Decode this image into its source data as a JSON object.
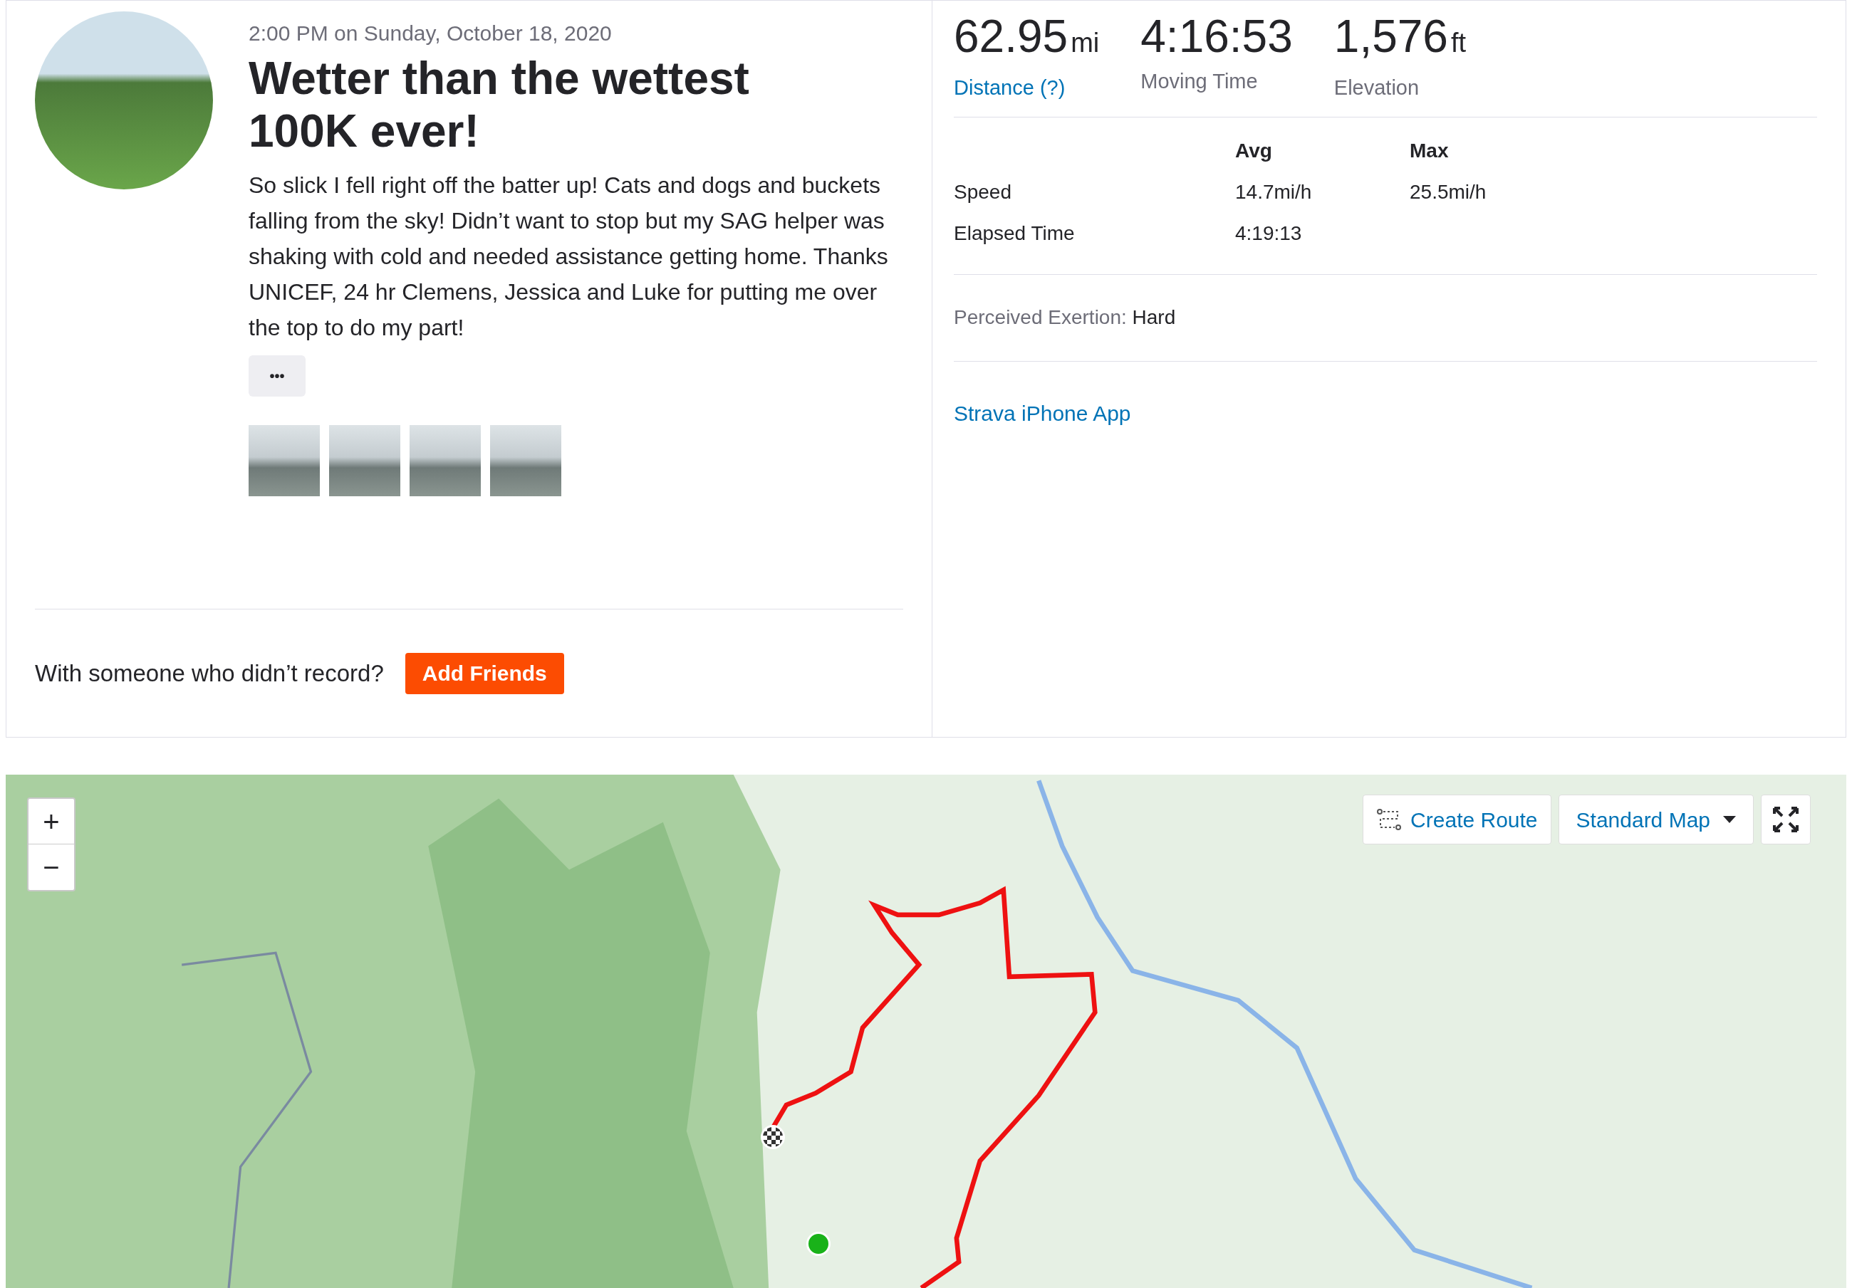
{
  "activity": {
    "date": "2:00 PM on Sunday, October 18, 2020",
    "title": "Wetter than the wettest 100K ever!",
    "description": "So slick I fell right off the batter up! Cats and dogs and buckets falling from the sky! Didn’t want to stop but my SAG helper was shaking with cold and needed assistance getting home. Thanks UNICEF, 24 hr Clemens, Jessica and Luke for putting me over the top to do my part!",
    "more_button": "•••"
  },
  "add_friends": {
    "prompt": "With someone who didn’t record?",
    "button": "Add Friends"
  },
  "stats": [
    {
      "value": "62.95",
      "unit": "mi",
      "label": "Distance (?)",
      "kind": "link"
    },
    {
      "value": "4:16:53",
      "label": "Moving Time",
      "kind": "plain"
    },
    {
      "value": "1,576",
      "unit": "ft",
      "label": "Elevation",
      "kind": "plain"
    }
  ],
  "table": {
    "columns": [
      "Avg",
      "Max"
    ],
    "rows": [
      {
        "label": "Speed",
        "avg": "14.7mi/h",
        "max": "25.5mi/h"
      },
      {
        "label": "Elapsed Time",
        "avg": "4:19:13"
      }
    ]
  },
  "exertion": {
    "label": "Perceived Exertion:",
    "value": "Hard"
  },
  "device": "Strava iPhone App",
  "map": {
    "zoom_in": "+",
    "zoom_out": "−",
    "create_route": "Create Route",
    "map_type": "Standard Map"
  }
}
